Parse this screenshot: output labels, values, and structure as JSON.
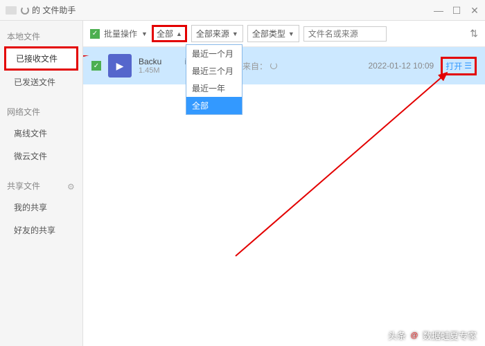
{
  "window": {
    "title": "的 文件助手"
  },
  "sidebar": {
    "sections": [
      {
        "head": "本地文件",
        "items": [
          "已接收文件",
          "已发送文件"
        ]
      },
      {
        "head": "网络文件",
        "items": [
          "离线文件",
          "微云文件"
        ]
      },
      {
        "head": "共享文件",
        "items": [
          "我的共享",
          "好友的共享"
        ]
      }
    ]
  },
  "toolbar": {
    "batch_label": "批量操作",
    "filter_time": "全部",
    "filter_source": "全部来源",
    "filter_type": "全部类型",
    "search_placeholder": "文件名或来源"
  },
  "dropdown_menu": {
    "items": [
      "最近一个月",
      "最近三个月",
      "最近一年",
      "全部"
    ],
    "selected_index": 3
  },
  "file": {
    "name": "Backu",
    "name_suffix": "it",
    "size": "1.45M",
    "from_label": "来自：",
    "date": "2022-01-12 10:09",
    "open_label": "打开"
  },
  "watermark": {
    "prefix": "头条",
    "author": "数据蛙夏专家"
  }
}
